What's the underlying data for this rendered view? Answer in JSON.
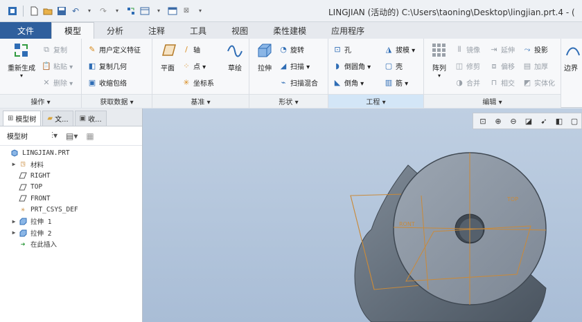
{
  "window": {
    "title": "LINGJIAN (活动的) C:\\Users\\taoning\\Desktop\\lingjian.prt.4 - ("
  },
  "tabs": [
    {
      "label": "文件"
    },
    {
      "label": "模型"
    },
    {
      "label": "分析"
    },
    {
      "label": "注释"
    },
    {
      "label": "工具"
    },
    {
      "label": "视图"
    },
    {
      "label": "柔性建模"
    },
    {
      "label": "应用程序"
    }
  ],
  "ribbon": {
    "operations": {
      "footer": "操作 ▾",
      "regenerate": "重新生成",
      "copy": "复制",
      "paste": "粘贴 ▾",
      "delete": "删除 ▾"
    },
    "get_data": {
      "footer": "获取数据 ▾",
      "udf": "用户定义特征",
      "copy_geometry": "复制几何",
      "shrinkwrap": "收缩包络"
    },
    "datum": {
      "footer": "基准 ▾",
      "plane": "平面",
      "axis": "轴",
      "point": "点 ▾",
      "csys": "坐标系",
      "sketch": "草绘"
    },
    "shape": {
      "footer": "形状 ▾",
      "extrude": "拉伸",
      "revolve": "旋转",
      "sweep": "扫描 ▾",
      "swept_blend": "扫描混合"
    },
    "engineering": {
      "footer": "工程 ▾",
      "hole": "孔",
      "round": "倒圆角 ▾",
      "chamfer": "倒角 ▾",
      "draft": "拔模 ▾",
      "shell": "壳",
      "rib": "筋 ▾"
    },
    "editing": {
      "footer": "编辑 ▾",
      "pattern": "阵列",
      "mirror": "镜像",
      "extend": "延伸",
      "project": "投影",
      "trim": "修剪",
      "offset": "偏移",
      "thicken": "加厚",
      "merge": "合并",
      "intersect": "相交",
      "solidify": "实体化"
    },
    "boundary": "边界"
  },
  "panel": {
    "tabs": [
      "模型树",
      "文...",
      "收..."
    ],
    "toolbar_label": "模型树",
    "tree": [
      {
        "label": "LINGJIAN.PRT",
        "expand": "",
        "icon": "part-icon"
      },
      {
        "label": "材料",
        "expand": "▶",
        "icon": "material-icon"
      },
      {
        "label": "RIGHT",
        "expand": "",
        "icon": "datum-plane-icon"
      },
      {
        "label": "TOP",
        "expand": "",
        "icon": "datum-plane-icon"
      },
      {
        "label": "FRONT",
        "expand": "",
        "icon": "datum-plane-icon"
      },
      {
        "label": "PRT_CSYS_DEF",
        "expand": "",
        "icon": "csys-icon"
      },
      {
        "label": "拉伸 1",
        "expand": "▶",
        "icon": "extrude-icon"
      },
      {
        "label": "拉伸 2",
        "expand": "▶",
        "icon": "extrude-icon"
      },
      {
        "label": "在此插入",
        "expand": "",
        "icon": "insert-here-icon"
      }
    ]
  },
  "viewport": {
    "labels": {
      "top": "TOP",
      "front": "RONT"
    }
  },
  "colors": {
    "file_tab": "#2f5f9d",
    "accent": "#2f6db5",
    "datum": "#c98a3a"
  }
}
